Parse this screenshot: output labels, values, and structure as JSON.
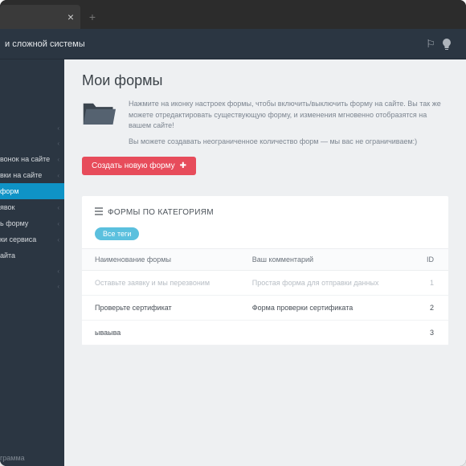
{
  "header": {
    "title": "и сложной системы"
  },
  "sidebar": {
    "items": [
      {
        "label": " ",
        "dim": true,
        "caret": true
      },
      {
        "label": " ",
        "dim": true,
        "caret": true
      },
      {
        "label": "вонок на сайте",
        "caret": true
      },
      {
        "label": "вки на сайте",
        "caret": true
      },
      {
        "label": "форм",
        "active": true
      },
      {
        "label": "явок",
        "caret": true
      },
      {
        "label": "ь форму",
        "caret": true
      },
      {
        "label": "ки сервиса",
        "caret": true
      },
      {
        "label": "айта"
      },
      {
        "label": " ",
        "dim": true,
        "caret": true
      },
      {
        "label": " ",
        "dim": true,
        "caret": true
      }
    ],
    "footer": {
      "label": "грамма"
    }
  },
  "page": {
    "title": "Мои формы",
    "intro_p1": "Нажмите на иконку настроек формы, чтобы включить/выключить форму на сайте. Вы так же можете отредактировать существующую форму, и изменения мгновенно отобразятся на вашем сайте!",
    "intro_p2": "Вы можете создавать неограниченное количество форм — мы вас не ограничиваем:)",
    "create_button": "Создать новую форму"
  },
  "panel": {
    "heading": "ФОРМЫ ПО КАТЕГОРИЯМ",
    "tag_all": "Все теги",
    "columns": {
      "name": "Наименование формы",
      "comment": "Ваш комментарий",
      "id": "ID"
    },
    "rows": [
      {
        "name": "Оставьте заявку и мы перезвоним",
        "comment": "Простая форма для отправки данных",
        "id": "1",
        "muted": true
      },
      {
        "name": "Проверьте сертификат",
        "comment": "Форма проверки сертификата",
        "id": "2"
      },
      {
        "name": "ываыва",
        "comment": "",
        "id": "3"
      }
    ]
  }
}
